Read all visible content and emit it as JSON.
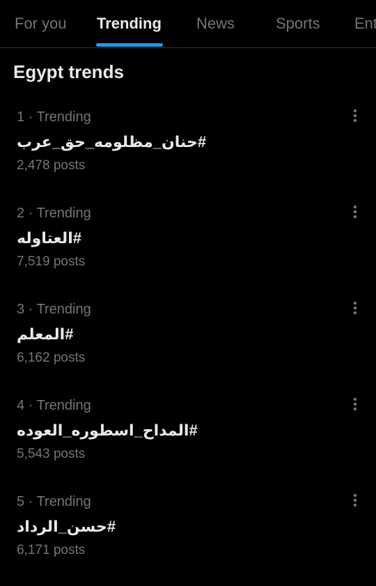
{
  "tabs": [
    {
      "label": "For you",
      "active": false
    },
    {
      "label": "Trending",
      "active": true
    },
    {
      "label": "News",
      "active": false
    },
    {
      "label": "Sports",
      "active": false
    },
    {
      "label": "Ent",
      "active": false
    }
  ],
  "section_title": "Egypt trends",
  "trends": [
    {
      "meta": "1 · Trending",
      "name": "#حنان_مظلومه_حق_عرب",
      "count": "2,478 posts"
    },
    {
      "meta": "2 · Trending",
      "name": "#العتاوله",
      "count": "7,519 posts"
    },
    {
      "meta": "3 · Trending",
      "name": "#المعلم",
      "count": "6,162 posts"
    },
    {
      "meta": "4 · Trending",
      "name": "#المداح_اسطوره_العوده",
      "count": "5,543 posts"
    },
    {
      "meta": "5 · Trending",
      "name": "#حسن_الرداد",
      "count": "6,171 posts"
    }
  ],
  "icons": {
    "more": "more-vertical-icon"
  },
  "colors": {
    "background": "#000000",
    "text_primary": "#e7e9ea",
    "text_secondary": "#71767b",
    "accent": "#1d9bf0",
    "divider": "#2f3336"
  }
}
